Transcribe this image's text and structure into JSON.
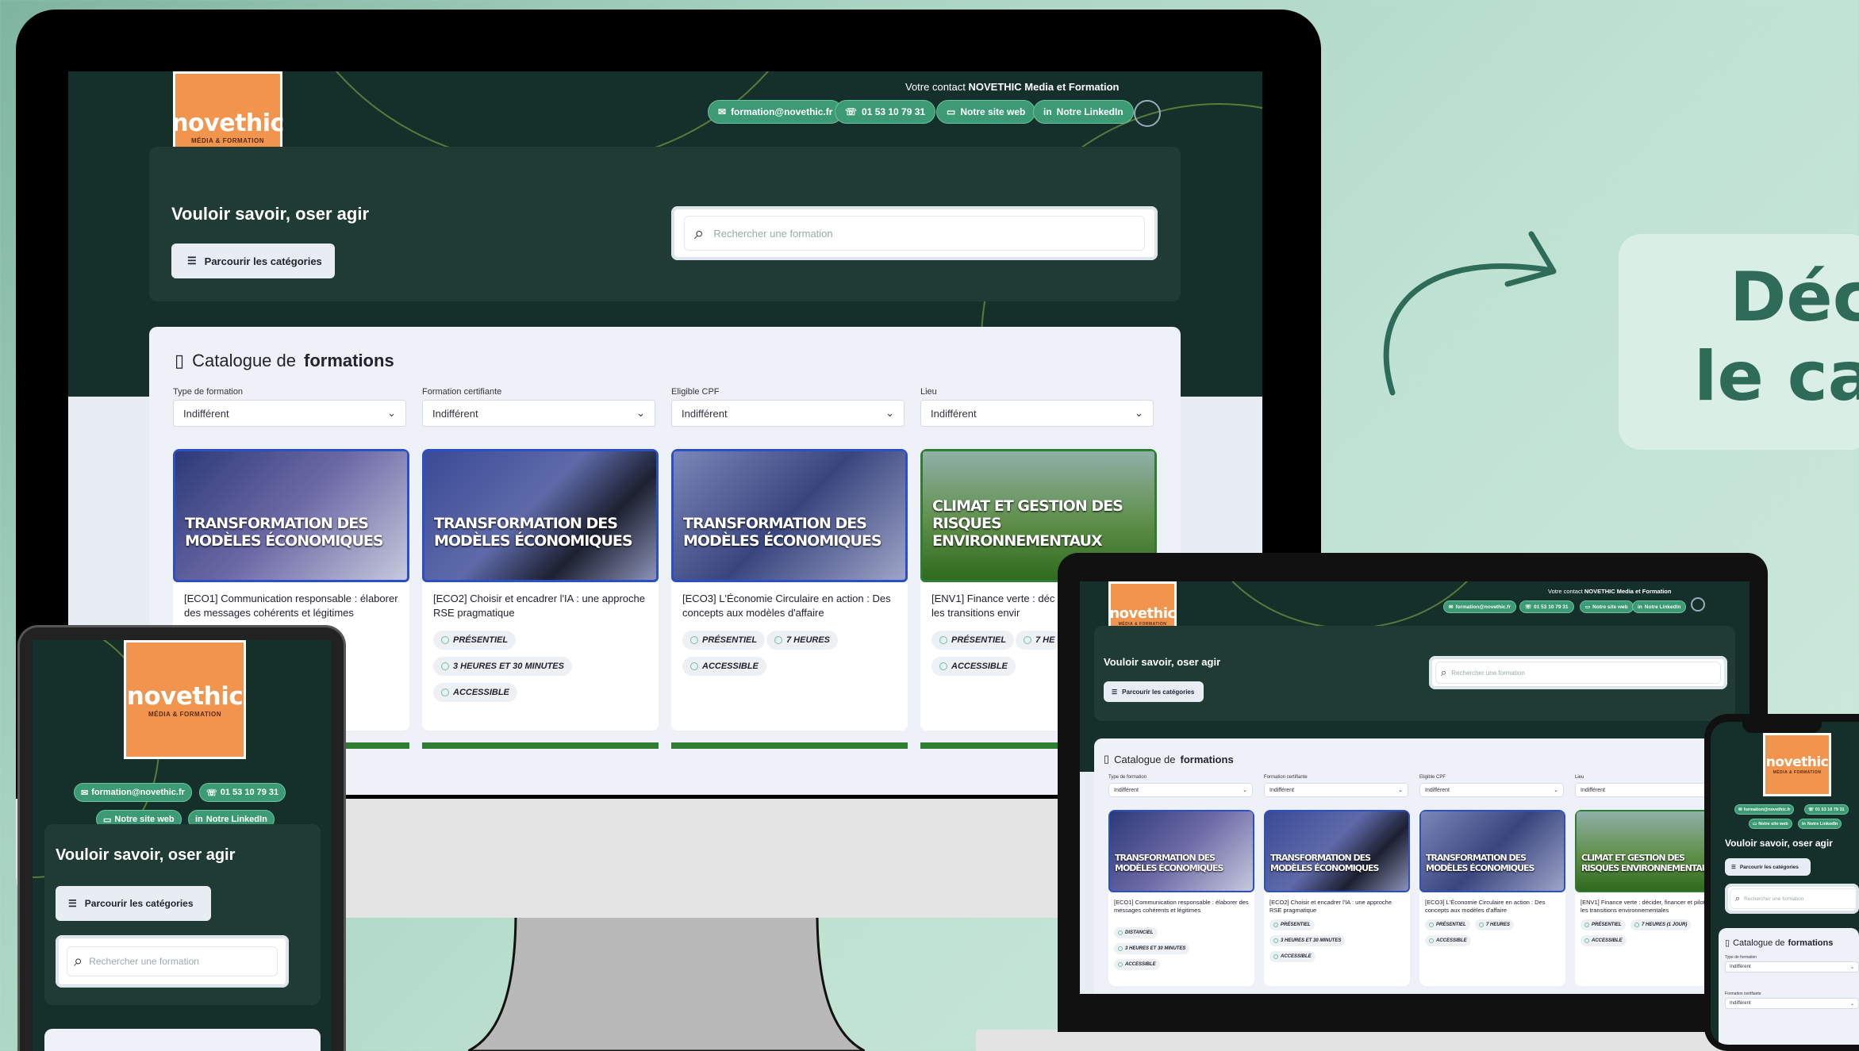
{
  "headline": {
    "line1": "Déc",
    "line2": "le ca"
  },
  "site": {
    "logo_text_a": "nove",
    "logo_text_b": "thic",
    "logo_sub": "MÉDIA & FORMATION",
    "contact_prefix": "Votre contact",
    "contact_bold": "NOVETHIC Media et Formation",
    "pills": [
      "formation@novethic.fr",
      "01 53 10 79 31",
      "Notre site web",
      "Notre LinkedIn"
    ],
    "tagline": "Vouloir savoir, oser agir",
    "browse_label": "Parcourir les catégories",
    "search_placeholder": "Rechercher une formation",
    "catalogue_prefix": "Catalogue de",
    "catalogue_bold": "formations",
    "filters": [
      {
        "label": "Type de formation",
        "value": "Indifférent"
      },
      {
        "label": "Formation certifiante",
        "value": "Indifférent"
      },
      {
        "label": "Eligible CPF",
        "value": "Indifférent"
      },
      {
        "label": "Lieu",
        "value": "Indifférent"
      }
    ],
    "cards": [
      {
        "banner1": "TRANSFORMATION DES",
        "banner2": "MODÈLES ÉCONOMIQUES",
        "title": "[ECO1] Communication responsable : élaborer des messages cohérents et légitimes",
        "badges": [
          "DISTANCIEL",
          "3 HEURES ET 30 MINUTES",
          "ACCESSIBLE"
        ]
      },
      {
        "banner1": "TRANSFORMATION DES",
        "banner2": "MODÈLES ÉCONOMIQUES",
        "title": "[ECO2] Choisir et encadrer l'IA : une approche RSE pragmatique",
        "badges": [
          "PRÉSENTIEL",
          "3 HEURES ET 30 MINUTES",
          "ACCESSIBLE"
        ]
      },
      {
        "banner1": "TRANSFORMATION DES",
        "banner2": "MODÈLES ÉCONOMIQUES",
        "title": "[ECO3] L'Économie Circulaire en action : Des concepts aux modèles d'affaire",
        "badges": [
          "PRÉSENTIEL",
          "7 HEURES",
          "ACCESSIBLE"
        ]
      },
      {
        "banner1": "CLIMAT ET GESTION DES",
        "banner2": "RISQUES ENVIRONNEMENTAUX",
        "title": "[ENV1] Finance verte : décider, financer et piloter les transitions environnementales",
        "badges": [
          "PRÉSENTIEL",
          "7 HEURES (1 JOUR)",
          "ACCESSIBLE"
        ]
      }
    ],
    "desktop_card4_title": "[ENV1] Finance verte : déc piloter les transitions envir",
    "desktop_card4_badge2": "7 HE"
  },
  "colors": {
    "accent": "#3c9a74",
    "dark": "#15302a",
    "logo": "#f0944e",
    "headline": "#2e6b58"
  }
}
